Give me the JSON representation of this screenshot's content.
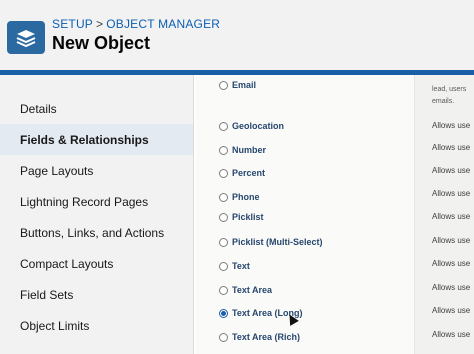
{
  "header": {
    "breadcrumb": [
      "SETUP",
      "OBJECT MANAGER"
    ],
    "breadcrumb_sep": ">",
    "title": "New Object"
  },
  "sidebar": {
    "items": [
      {
        "label": "Details"
      },
      {
        "label": "Fields & Relationships"
      },
      {
        "label": "Page Layouts"
      },
      {
        "label": "Lightning Record Pages"
      },
      {
        "label": "Buttons, Links, and Actions"
      },
      {
        "label": "Compact Layouts"
      },
      {
        "label": "Field Sets"
      },
      {
        "label": "Object Limits"
      }
    ]
  },
  "data_types": [
    {
      "label": "Email",
      "selected": false
    },
    {
      "label": "Geolocation",
      "selected": false
    },
    {
      "label": "Number",
      "selected": false
    },
    {
      "label": "Percent",
      "selected": false
    },
    {
      "label": "Phone",
      "selected": false
    },
    {
      "label": "Picklist",
      "selected": false
    },
    {
      "label": "Picklist (Multi-Select)",
      "selected": false
    },
    {
      "label": "Text",
      "selected": false
    },
    {
      "label": "Text Area",
      "selected": false
    },
    {
      "label": "Text Area (Long)",
      "selected": true
    },
    {
      "label": "Text Area (Rich)",
      "selected": false
    }
  ],
  "descriptions": {
    "top": [
      "lead, users",
      "emails."
    ],
    "rows": [
      "Allows use",
      "Allows use",
      "Allows use",
      "Allows use",
      "Allows use",
      "Allows use",
      "Allows use",
      "Allows use",
      "Allows use",
      "Allows use"
    ]
  },
  "colors": {
    "accent": "#1b5ea8",
    "link": "#0b5fb3",
    "icon_bg": "#2b6aa0"
  }
}
